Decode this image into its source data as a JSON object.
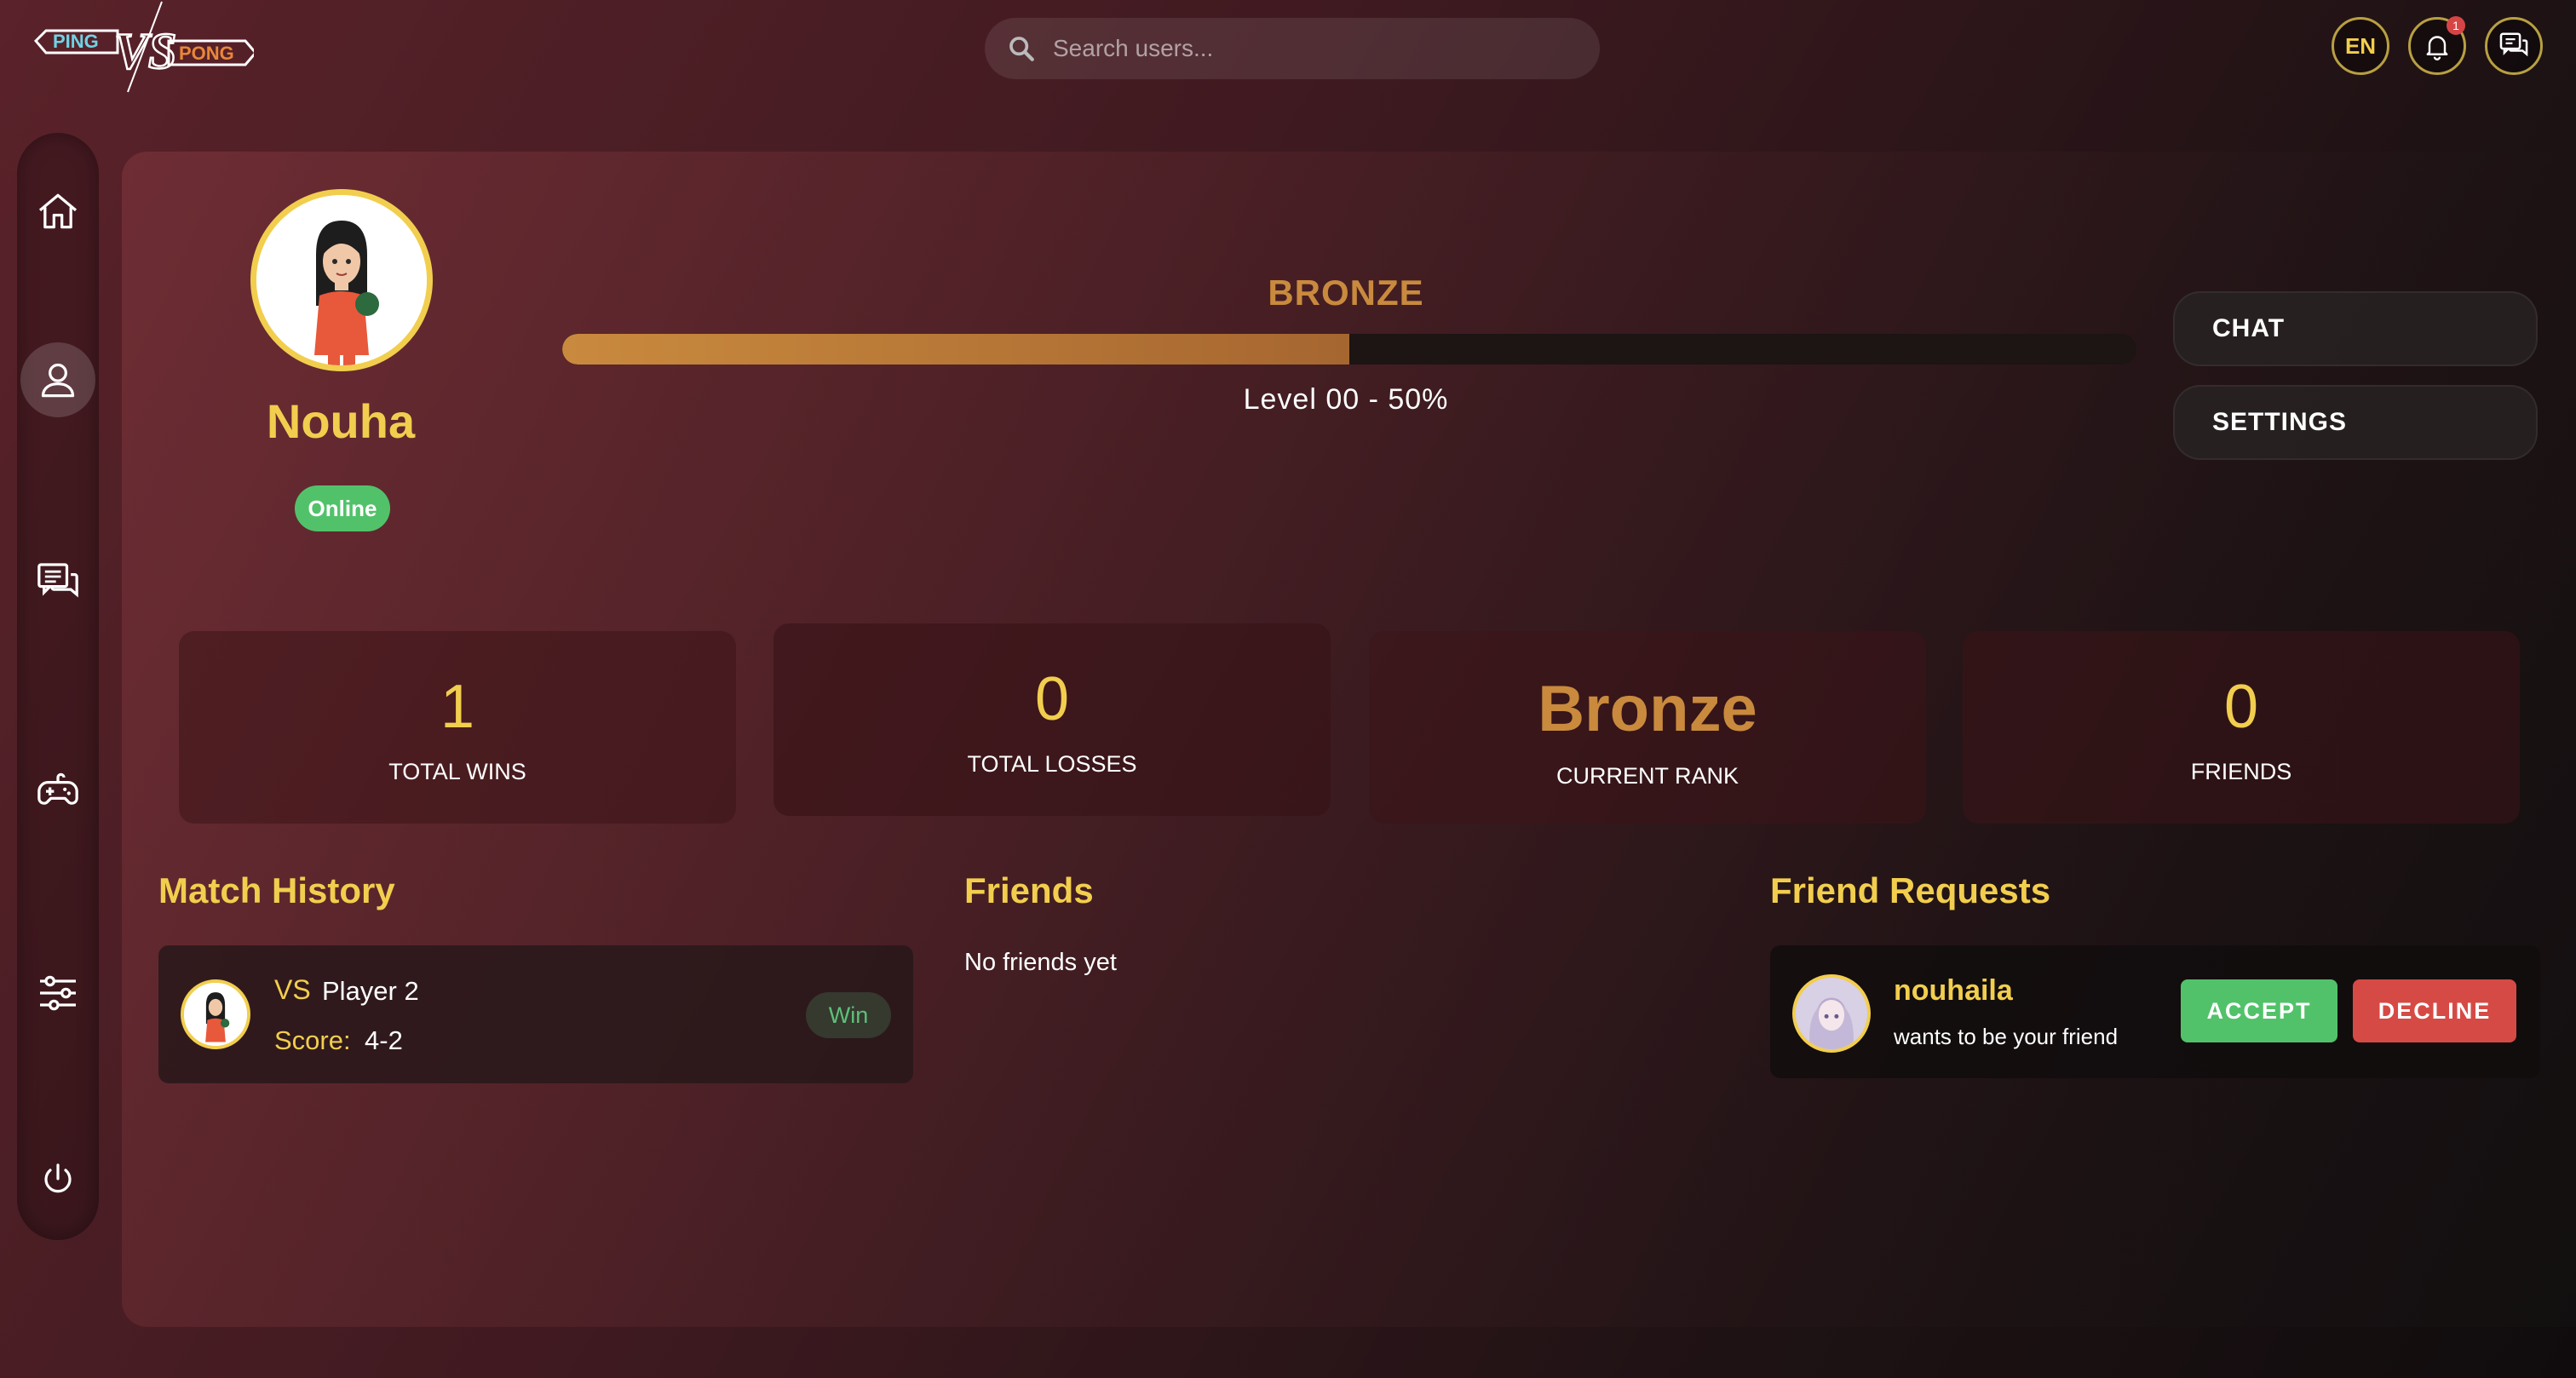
{
  "header": {
    "logo_left": "PING",
    "logo_mid": "VS",
    "logo_right": "PONG",
    "search_placeholder": "Search users...",
    "language": "EN",
    "notification_count": "1"
  },
  "sidebar": {
    "items": [
      {
        "name": "home",
        "icon": "home-icon",
        "active": false
      },
      {
        "name": "profile",
        "icon": "user-icon",
        "active": true
      },
      {
        "name": "chat",
        "icon": "chat-icon",
        "active": false
      },
      {
        "name": "game",
        "icon": "gamepad-icon",
        "active": false
      },
      {
        "name": "settings",
        "icon": "sliders-icon",
        "active": false
      },
      {
        "name": "logout",
        "icon": "power-icon",
        "active": false
      }
    ]
  },
  "profile": {
    "username": "Nouha",
    "status": "Online",
    "rank_title": "BRONZE",
    "progress_percent": 50,
    "level_text": "Level 00 - 50%",
    "chat_label": "CHAT",
    "settings_label": "SETTINGS"
  },
  "stats": [
    {
      "value": "1",
      "label": "TOTAL WINS"
    },
    {
      "value": "0",
      "label": "TOTAL LOSSES"
    },
    {
      "value": "Bronze",
      "label": "CURRENT RANK"
    },
    {
      "value": "0",
      "label": "FRIENDS"
    }
  ],
  "match_history": {
    "title": "Match History",
    "items": [
      {
        "vs": "VS",
        "opponent": "Player 2",
        "score_label": "Score:",
        "score": "4-2",
        "result": "Win"
      }
    ]
  },
  "friends": {
    "title": "Friends",
    "empty_text": "No friends yet"
  },
  "friend_requests": {
    "title": "Friend Requests",
    "items": [
      {
        "name": "nouhaila",
        "message": "wants to be your friend",
        "accept_label": "ACCEPT",
        "decline_label": "DECLINE"
      }
    ]
  },
  "colors": {
    "accent_yellow": "#f2ce4e",
    "bronze": "#c98a3e",
    "online_green": "#52c26a",
    "decline_red": "#d64a45"
  }
}
